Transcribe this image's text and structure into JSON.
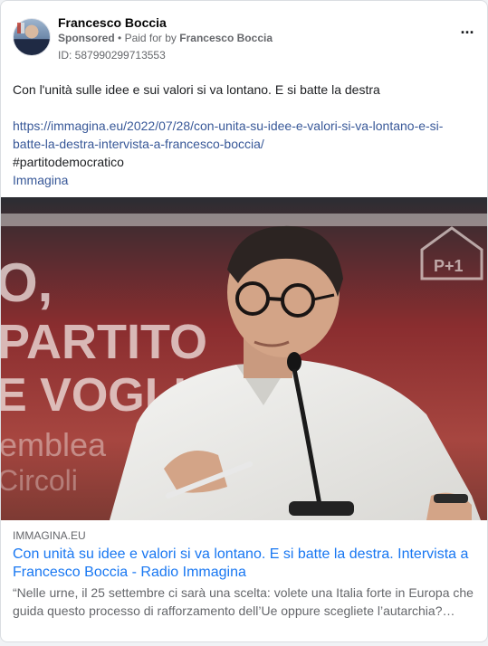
{
  "post": {
    "author": "Francesco Boccia",
    "sponsored_label": "Sponsored",
    "paid_for_label": "Paid for by",
    "paid_for_name": "Francesco Boccia",
    "ad_id": "ID: 587990299713553",
    "more_icon": "more-horizontal-icon",
    "message": "Con l'unità sulle idee e sui valori si va lontano. E si batte la destra",
    "url_line1": "https://immagina.eu/2022/07/28/con-unita-su-idee-e-valori-si-va-lontano-e-si-",
    "url_line2": "batte-la-destra-intervista-a-francesco-boccia/",
    "hashtag": "#partitodemocratico",
    "tag_link": "Immagina"
  },
  "media": {
    "banner_texts": [
      "O,",
      "PARTITO",
      "E VOGLI",
      "emblea",
      "Circoli"
    ],
    "logo_text": "P+1"
  },
  "link_preview": {
    "domain": "IMMAGINA.EU",
    "headline": "Con unità su idee e valori si va lontano. E si batte la destra. Intervista a Francesco Boccia - Radio Immagina",
    "description": "“Nelle urne, il 25 settembre ci sarà una scelta: volete una Italia forte in Europa che guida questo processo di rafforzamento dell’Ue oppure scegliete l’autarchia?…"
  },
  "colors": {
    "link_blue": "#385898",
    "headline_blue": "#1877f2",
    "muted_text": "#65676b"
  }
}
